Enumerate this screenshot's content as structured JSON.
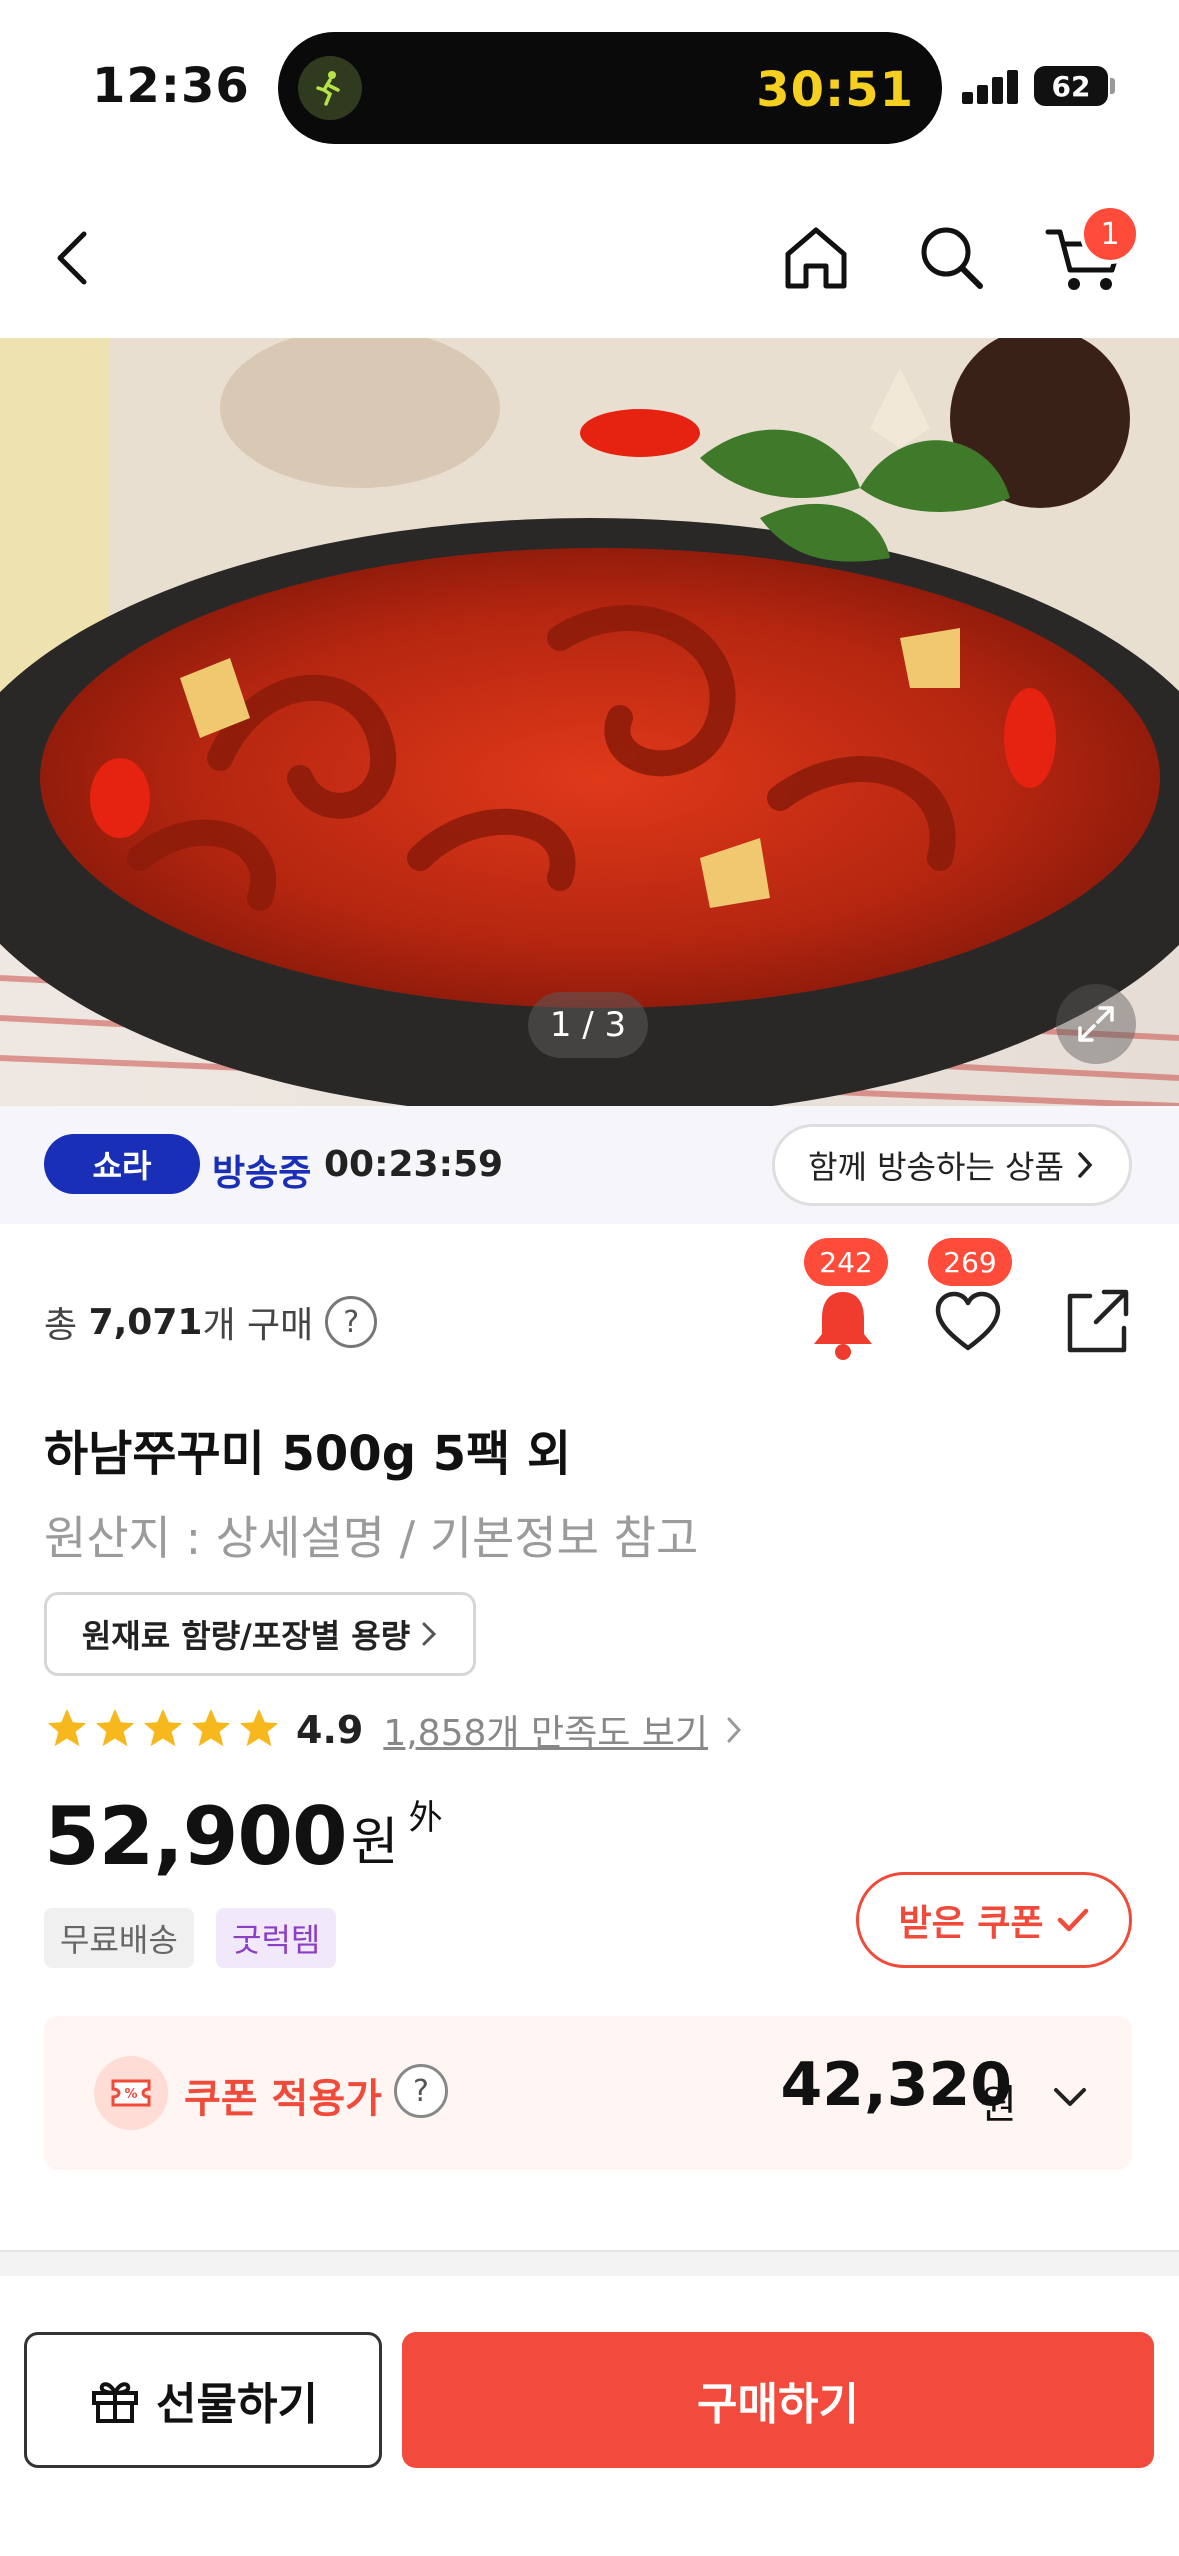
{
  "status_bar": {
    "time": "12:36",
    "activity_timer": "30:51",
    "battery": "62"
  },
  "nav": {
    "cart_count": "1"
  },
  "gallery": {
    "pager": "1 / 3"
  },
  "live": {
    "badge": "쇼라",
    "status": "방송중",
    "countdown": "00:23:59",
    "together_button": "함께 방송하는 상품"
  },
  "product": {
    "purchase_prefix": "총",
    "purchase_count": "7,071",
    "purchase_suffix": "개 구매",
    "alarm_count": "242",
    "wish_count": "269",
    "title": "하남쭈꾸미 500g 5팩 외",
    "origin": "원산지 : 상세설명 / 기본정보 참고",
    "raw_button": "원재료 함량/포장별 용량",
    "rating": 4.9,
    "rating_text": "4.9",
    "stars": 5,
    "reviews_link": "1,858개 만족도 보기",
    "price": "52,900",
    "price_unit": "원",
    "price_extra": "外",
    "tags": [
      "무료배송",
      "굿럭템"
    ],
    "coupon_received": "받은 쿠폰",
    "coupon_label": "쿠폰 적용가",
    "coupon_price": "42,320",
    "coupon_unit": "원"
  },
  "actions": {
    "gift": "선물하기",
    "buy": "구매하기"
  },
  "colors": {
    "accent": "#f24a3c",
    "live_blue": "#1a2fb8",
    "star": "#f6b81c",
    "island_timer": "#f5d020"
  },
  "icons": [
    "back-icon",
    "home-icon",
    "search-icon",
    "cart-icon",
    "expand-icon",
    "bell-icon",
    "heart-icon",
    "share-icon",
    "star-icon",
    "gift-icon",
    "coupon-icon",
    "chevron-down-icon"
  ]
}
